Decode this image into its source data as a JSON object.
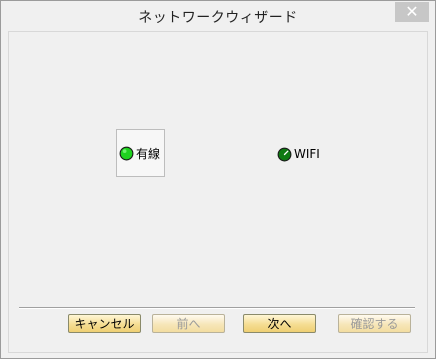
{
  "window": {
    "title": "ネットワークウィザード",
    "close_symbol": "✕"
  },
  "options": {
    "wired": {
      "label": "有線",
      "led_color": "#1fd21f",
      "selected": true
    },
    "wifi": {
      "label": "WIFI",
      "led_color": "#0f7a12",
      "selected": false
    }
  },
  "buttons": {
    "cancel": "キャンセル",
    "prev": "前へ",
    "next": "次へ",
    "confirm": "確認する"
  }
}
